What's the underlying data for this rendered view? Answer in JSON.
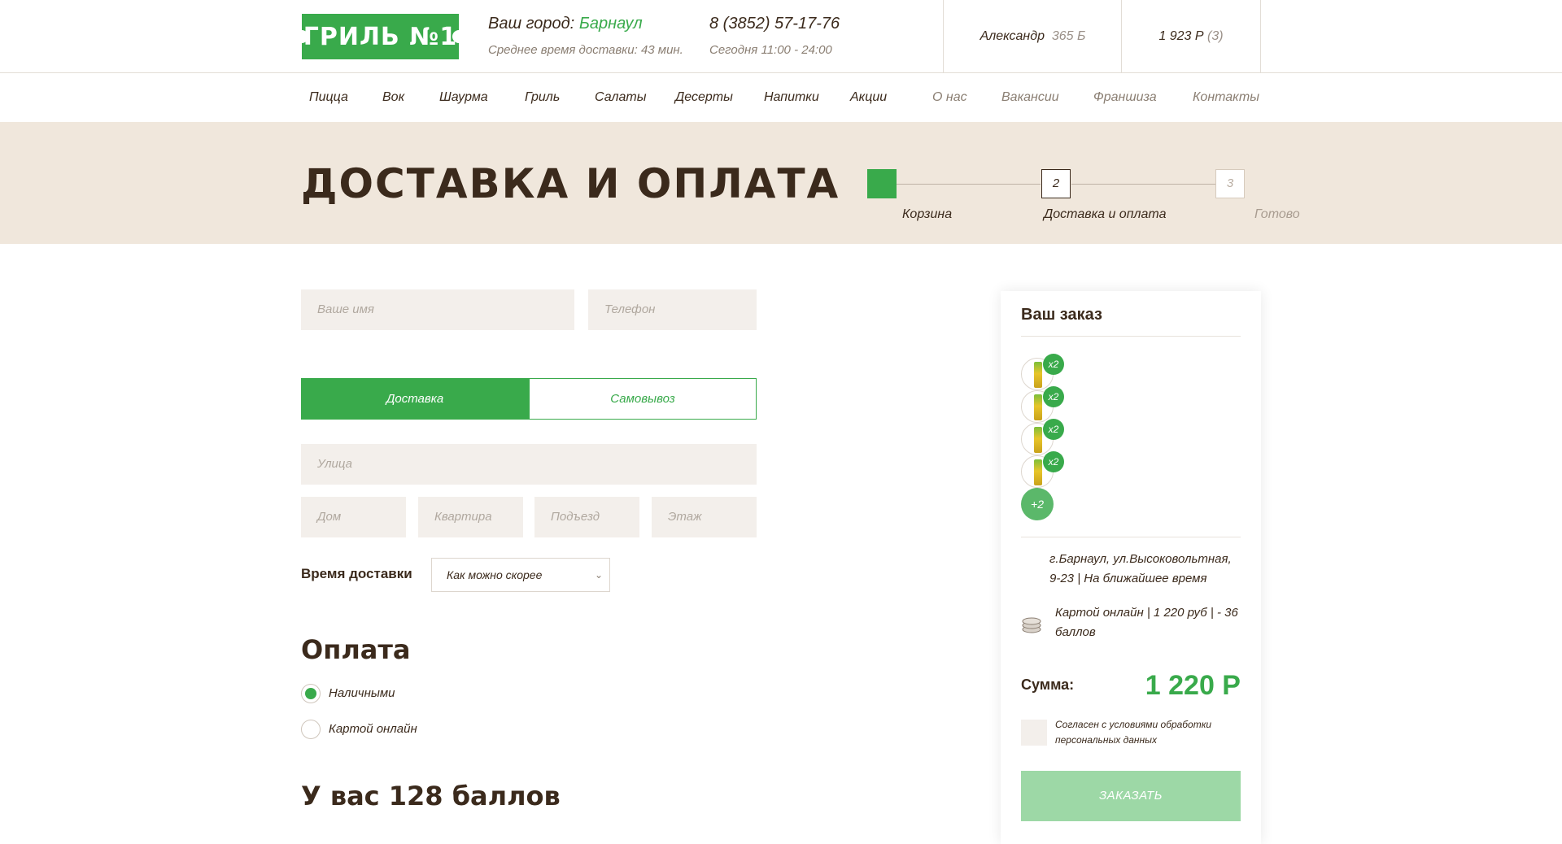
{
  "header": {
    "logo_text": "ГРИЛЬ №1",
    "city_label": "Ваш город:",
    "city_value": "Барнаул",
    "delivery_time": "Среднее время доставки: 43 мин.",
    "phone": "8 (3852) 57-17-76",
    "hours": "Сегодня 11:00 - 24:00",
    "user_name": "Александр",
    "user_points": "365 Б",
    "cart_total": "1 923 Р",
    "cart_count": "(3)"
  },
  "nav": {
    "items": [
      "Пицца",
      "Вок",
      "Шаурма",
      "Гриль",
      "Салаты",
      "Десерты",
      "Напитки",
      "Акции"
    ],
    "secondary": [
      "О нас",
      "Вакансии",
      "Франшиза",
      "Контакты"
    ]
  },
  "banner": {
    "title": "ДОСТАВКА И ОПЛАТА",
    "steps": [
      {
        "number": "",
        "label": "Корзина",
        "state": "done"
      },
      {
        "number": "2",
        "label": "Доставка и оплата",
        "state": "current"
      },
      {
        "number": "3",
        "label": "Готово",
        "state": "pending"
      }
    ]
  },
  "form": {
    "name_placeholder": "Ваше имя",
    "phone_placeholder": "Телефон",
    "tab_delivery": "Доставка",
    "tab_pickup": "Самовывоз",
    "street_placeholder": "Улица",
    "house_placeholder": "Дом",
    "apartment_placeholder": "Квартира",
    "entrance_placeholder": "Подъезд",
    "floor_placeholder": "Этаж",
    "delivery_time_label": "Время доставки",
    "delivery_time_value": "Как можно скорее",
    "payment_title": "Оплата",
    "payment_cash": "Наличными",
    "payment_card": "Картой онлайн",
    "points_title": "У вас 128 баллов"
  },
  "order": {
    "title": "Ваш заказ",
    "items": [
      {
        "qty": "x2",
        "icon": "juice-can-icon"
      },
      {
        "qty": "x2",
        "icon": "juice-can-icon"
      },
      {
        "qty": "x2",
        "icon": "juice-can-icon"
      },
      {
        "qty": "x2",
        "icon": "juice-can-icon"
      }
    ],
    "more": "+2",
    "address": "г.Барнаул, ул.Высоковольтная, 9-23 | На ближайшее время",
    "payment_info": "Картой онлайн | 1 220 руб | - 36 баллов",
    "sum_label": "Сумма:",
    "sum_value": "1 220 Р",
    "consent": "Согласен с условиями обработки персональных данных",
    "order_button": "ЗАКАЗАТЬ"
  },
  "colors": {
    "accent": "#39aa4b",
    "brown": "#3b2a1c",
    "banner_bg": "#f0e7dc",
    "field_bg": "#f3efeb",
    "disabled_button": "#9dd8a6"
  }
}
